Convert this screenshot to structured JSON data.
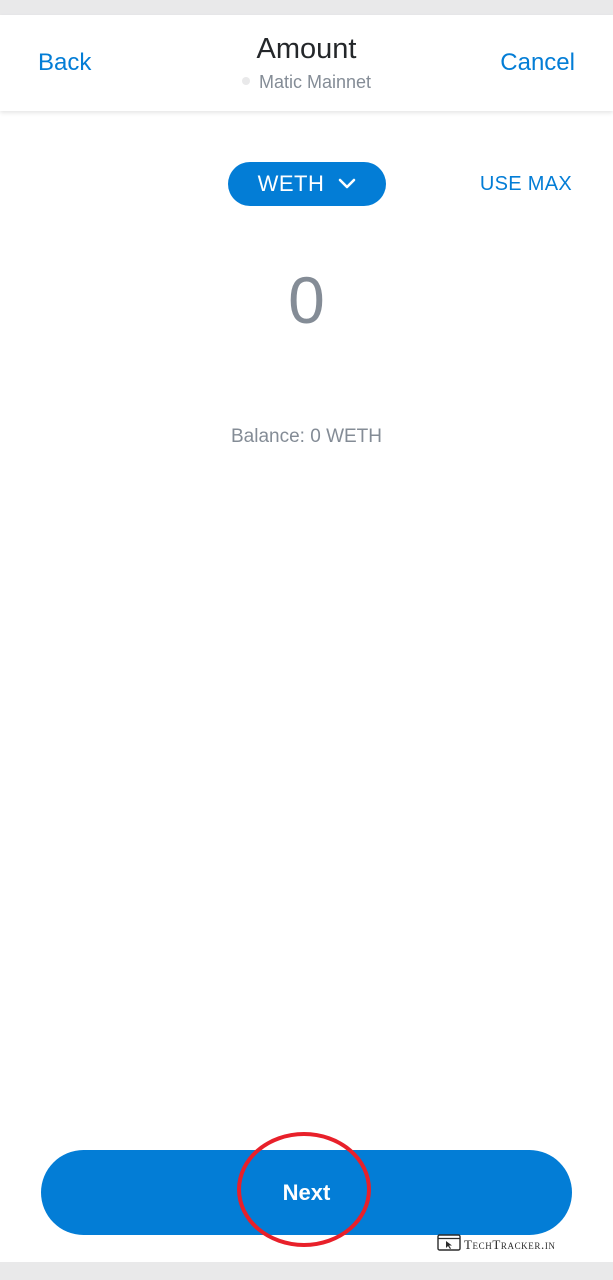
{
  "header": {
    "back_label": "Back",
    "title": "Amount",
    "network": "Matic Mainnet",
    "cancel_label": "Cancel"
  },
  "token_selector": {
    "symbol": "WETH",
    "icon": "chevron-down-icon"
  },
  "use_max_label": "USE MAX",
  "amount": {
    "value": "0"
  },
  "balance_text": "Balance: 0 WETH",
  "next_label": "Next",
  "watermark": {
    "text": "TechTracker.in"
  },
  "colors": {
    "accent": "#037dd6",
    "muted_text": "#848c96",
    "highlight_ring": "#e8202a"
  }
}
